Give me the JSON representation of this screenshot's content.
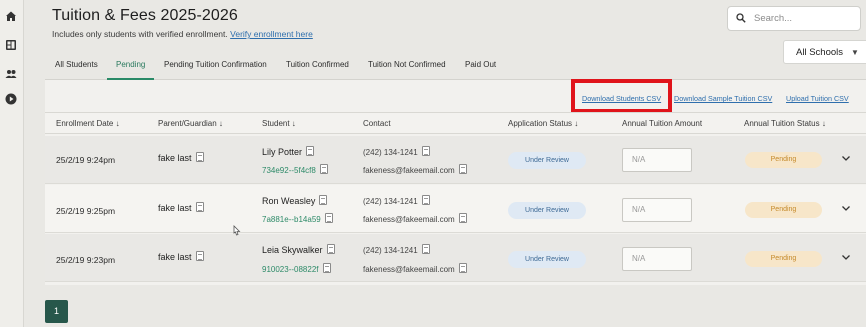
{
  "page": {
    "title": "Tuition & Fees 2025-2026",
    "subtitle": "Includes only students with verified enrollment.",
    "subtitle_link": "Verify enrollment here"
  },
  "search": {
    "placeholder": "Search..."
  },
  "school_filter": {
    "selected": "All Schools"
  },
  "tabs": [
    {
      "label": "All Students",
      "active": false
    },
    {
      "label": "Pending",
      "active": true
    },
    {
      "label": "Pending Tuition Confirmation",
      "active": false
    },
    {
      "label": "Tuition Confirmed",
      "active": false
    },
    {
      "label": "Tuition Not Confirmed",
      "active": false
    },
    {
      "label": "Paid Out",
      "active": false
    }
  ],
  "actions": {
    "download_students": "Download Students CSV",
    "download_sample": "Download Sample Tuition CSV",
    "upload": "Upload Tuition CSV"
  },
  "columns": [
    "Enrollment Date ↓",
    "Parent/Guardian ↓",
    "Student ↓",
    "Contact",
    "Application Status ↓",
    "Annual Tuition Amount",
    "Annual Tuition Status ↓"
  ],
  "rows": [
    {
      "date": "25/2/19 9:24pm",
      "parent": "fake last",
      "student": "Lily Potter",
      "student_id": "734e92--5f4cf8",
      "phone": "(242) 134-1241",
      "email": "fakeness@fakeemail.com",
      "app_status": "Under Review",
      "tuition_amount": "N/A",
      "tuition_status": "Pending"
    },
    {
      "date": "25/2/19 9:25pm",
      "parent": "fake last",
      "student": "Ron Weasley",
      "student_id": "7a881e--b14a59",
      "phone": "(242) 134-1241",
      "email": "fakeness@fakeemail.com",
      "app_status": "Under Review",
      "tuition_amount": "N/A",
      "tuition_status": "Pending"
    },
    {
      "date": "25/2/19 9:23pm",
      "parent": "fake last",
      "student": "Leia Skywalker",
      "student_id": "910023--08822f",
      "phone": "(242) 134-1241",
      "email": "fakeness@fakeemail.com",
      "app_status": "Under Review",
      "tuition_amount": "N/A",
      "tuition_status": "Pending"
    }
  ],
  "pagination": {
    "current": "1"
  },
  "colors": {
    "accent": "#2a8a67",
    "link": "#2f6fad",
    "highlight": "#e0141b",
    "review_bg": "#dfe9f4",
    "pending_bg": "#f7e6c9"
  },
  "icons": [
    "home-icon",
    "dashboard-icon",
    "users-icon",
    "play-icon",
    "search-icon",
    "chevron-down-icon",
    "document-icon"
  ]
}
